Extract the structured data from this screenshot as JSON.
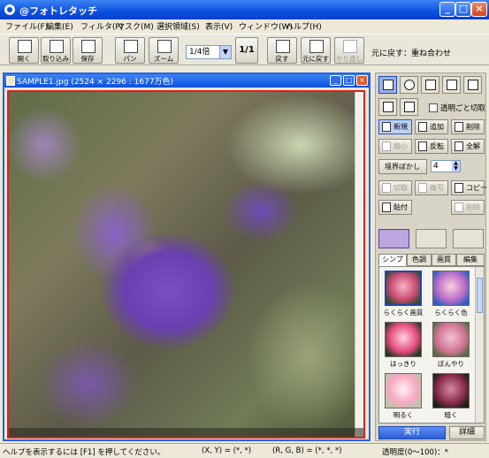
{
  "app": {
    "title": "@フォトレタッチ"
  },
  "menu": [
    "ファイル(F)",
    "編集(E)",
    "フィルタ(P)",
    "マスク(M)",
    "選択領域(S)",
    "表示(V)",
    "ウィンドウ(W)",
    "ヘルプ(H)"
  ],
  "toolbar": {
    "buttons": [
      "開く",
      "取り込み",
      "保存",
      "パン",
      "ズーム",
      "戻す",
      "元に戻す",
      "やり直し"
    ],
    "zoom_value": "1/4倍",
    "ratio_label": "1/1",
    "undo_hint": "元に戻す：重ね合わせ"
  },
  "document": {
    "title": "SAMPLE1.jpg (2524 × 2296 : 1677万色)"
  },
  "panel": {
    "transparent_cut_label": "透明ごと切取",
    "select_buttons": [
      "新規",
      "追加",
      "削除",
      "縮小",
      "反転",
      "全解"
    ],
    "blur_label": "境界ぼかし",
    "blur_value": "4",
    "edit_buttons": [
      "切取",
      "複写",
      "コピー",
      "貼付",
      "削除"
    ],
    "subtabs": [
      "シンプル",
      "色調",
      "画質",
      "編集"
    ],
    "presets": [
      "らくらく画質",
      "らくらく色",
      "はっきり",
      "ぼんやり",
      "明るく",
      "暗く"
    ],
    "run_label": "実行",
    "detail_label": "詳細"
  },
  "status": {
    "help": "ヘルプを表示するには [F1] を押してください。",
    "coords": "(X, Y) = (*, *)",
    "rgb": "(R, G, B) = (*, *, *)",
    "transparency": "透明度(0～100)：*"
  },
  "colors": {
    "titlebar": "#0a4fe0",
    "selection_border": "#e41e1e"
  }
}
